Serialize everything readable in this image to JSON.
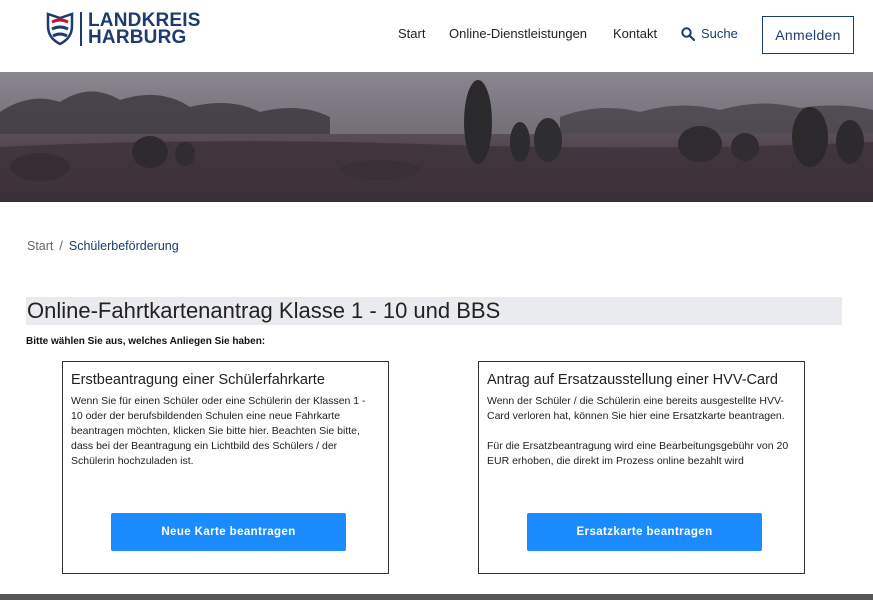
{
  "header": {
    "logo_line1": "LANDKREIS",
    "logo_line2": "HARBURG",
    "nav": {
      "start": "Start",
      "online": "Online-Dienstleistungen",
      "kontakt": "Kontakt",
      "search": "Suche"
    },
    "login_label": "Anmelden"
  },
  "breadcrumb": {
    "home": "Start",
    "separator": "/",
    "current": "Schülerbeförderung"
  },
  "page": {
    "title": "Online-Fahrtkartenantrag Klasse 1 - 10 und BBS",
    "subtitle": "Bitte wählen Sie aus, welches Anliegen Sie haben:"
  },
  "cards": [
    {
      "title": "Erstbeantragung einer Schülerfahrkarte",
      "text1": "Wenn Sie für einen Schüler oder eine Schülerin der Klassen 1 - 10 oder der berufsbildenden Schulen eine neue Fahrkarte beantragen möchten, klicken Sie bitte hier. Beachten Sie bitte, dass bei der Beantragung ein Lichtbild des Schülers / der Schülerin hochzuladen ist.",
      "button": "Neue Karte beantragen"
    },
    {
      "title": "Antrag auf Ersatzausstellung einer HVV-Card",
      "text1": "Wenn der Schüler / die Schülerin eine bereits ausgestellte HVV-Card verloren hat, können Sie hier eine Ersatzkarte beantragen.",
      "text2": "Für die Ersatzbeantragung wird eine Bearbeitungsgebühr von 20 EUR erhoben, die direkt im Prozess online bezahlt wird",
      "button": "Ersatzkarte beantragen"
    }
  ],
  "colors": {
    "brand": "#1d3b6e",
    "accent_button": "#1a8cff",
    "title_bg": "#e9ebee"
  }
}
